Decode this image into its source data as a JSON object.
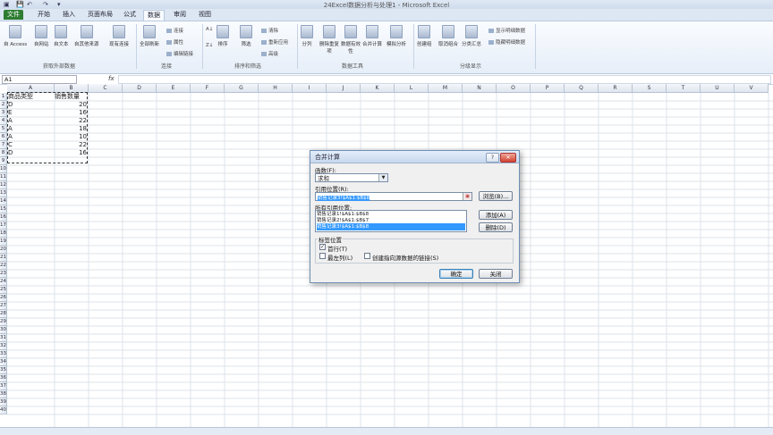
{
  "window": {
    "title": "24Excel数据分析与处理1 - Microsoft Excel"
  },
  "tabs": [
    {
      "label": "文件"
    },
    {
      "label": "开始"
    },
    {
      "label": "插入"
    },
    {
      "label": "页面布局"
    },
    {
      "label": "公式"
    },
    {
      "label": "数据"
    },
    {
      "label": "审阅"
    },
    {
      "label": "视图"
    }
  ],
  "ribbon": {
    "ext": {
      "access": "自 Access",
      "web": "自网站",
      "text": "自文本",
      "other": "自其他来源",
      "existing": "现有连接",
      "group": "获取外部数据"
    },
    "conn": {
      "refresh": "全部刷新",
      "links": "连接",
      "props": "属性",
      "edit": "编辑链接",
      "group": "连接"
    },
    "sort": {
      "sort": "排序",
      "filter": "筛选",
      "clear": "清除",
      "reapply": "重新应用",
      "adv": "高级",
      "group": "排序和筛选"
    },
    "tools": {
      "split": "分列",
      "dedup": "删除重复项",
      "valid": "数据有效性",
      "consolidate": "合并计算",
      "whatif": "模拟分析",
      "group": "数据工具"
    },
    "outline": {
      "grp": "创建组",
      "ungrp": "取消组合",
      "subtotal": "分类汇总",
      "show": "显示明细数据",
      "hide": "隐藏明细数据",
      "group": "分级显示"
    }
  },
  "formula_bar": {
    "name_box": "A1",
    "fx": "fx"
  },
  "columns": [
    "A",
    "B",
    "C",
    "D",
    "E",
    "F",
    "G",
    "H",
    "I",
    "J",
    "K",
    "L",
    "M",
    "N",
    "O",
    "P",
    "Q",
    "R",
    "S",
    "T",
    "U",
    "V"
  ],
  "rows": [
    "1",
    "2",
    "3",
    "4",
    "5",
    "6",
    "7",
    "8",
    "9",
    "10",
    "11",
    "12",
    "13",
    "14",
    "15",
    "16",
    "17",
    "18",
    "19",
    "20",
    "21",
    "22",
    "23",
    "24",
    "25",
    "26",
    "27",
    "28",
    "29",
    "30",
    "31",
    "32",
    "33",
    "34",
    "35",
    "36",
    "37",
    "38",
    "39",
    "40"
  ],
  "sheet": {
    "header": [
      "商品类型",
      "销售数量"
    ],
    "data": [
      [
        "D",
        "20"
      ],
      [
        "E",
        "16"
      ],
      [
        "A",
        "22"
      ],
      [
        "A",
        "18"
      ],
      [
        "A",
        "10"
      ],
      [
        "C",
        "22"
      ],
      [
        "D",
        "16"
      ]
    ]
  },
  "dialog": {
    "title": "合并计算",
    "function_label": "函数(F):",
    "function_value": "求和",
    "ref_label": "引用位置(R):",
    "ref_value": "销售记录3!$A$1:$B$8",
    "browse": "浏览(B)...",
    "all_refs_label": "所有引用位置:",
    "refs": [
      "销售记录1!$A$1:$B$8",
      "销售记录2!$A$1:$B$7",
      "销售记录3!$A$1:$B$8"
    ],
    "add": "添加(A)",
    "delete": "删除(D)",
    "tag_label": "标签位置",
    "first_row": "首行(T)",
    "left_col": "最左列(L)",
    "link": "创建指向源数据的链接(S)",
    "ok": "确定",
    "cancel": "关闭"
  }
}
